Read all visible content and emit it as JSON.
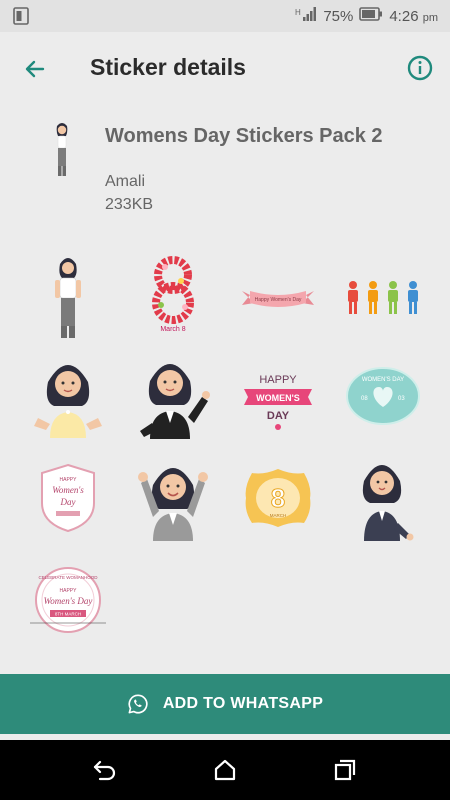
{
  "status_bar": {
    "battery_percent": "75%",
    "time": "4:26",
    "time_suffix": "pm"
  },
  "app_bar": {
    "title": "Sticker details",
    "back_icon": "arrow-left-icon",
    "info_icon": "info-icon"
  },
  "pack": {
    "name": "Womens Day Stickers Pack 2",
    "author": "Amali",
    "size": "233KB"
  },
  "stickers": [
    {
      "name": "woman-white-top"
    },
    {
      "name": "flower-eight-march"
    },
    {
      "name": "happy-womens-day-ribbon"
    },
    {
      "name": "colorful-people-row"
    },
    {
      "name": "woman-yellow-shirt-hands-hips"
    },
    {
      "name": "woman-black-suit-thumbs-up"
    },
    {
      "name": "happy-womens-day-badge"
    },
    {
      "name": "womens-day-heart-label"
    },
    {
      "name": "womens-day-emblem"
    },
    {
      "name": "woman-gray-suit-cheering"
    },
    {
      "name": "gold-eight-badge"
    },
    {
      "name": "woman-dark-suit-pointing"
    },
    {
      "name": "celebrate-womens-day-seal"
    }
  ],
  "sticker_text": {
    "march8": "March 8",
    "ribbon": "Happy Women's Day",
    "badge_happy": "HAPPY",
    "badge_womens": "WOMEN'S",
    "badge_day": "DAY",
    "label_top": "WOMEN'S DAY",
    "label_left": "08",
    "label_right": "03",
    "emblem_happy": "HAPPY",
    "emblem_line1": "Women's",
    "emblem_line2": "Day",
    "gold_eight": "8",
    "gold_sub": "MARCH",
    "seal_arc": "CELEBRATE WOMANHOOD",
    "seal_line1": "HAPPY",
    "seal_line2": "Women's Day",
    "seal_date": "8TH MARCH"
  },
  "action": {
    "label": "ADD TO WHATSAPP",
    "icon": "whatsapp-icon",
    "color": "#2e8b7a"
  },
  "nav": {
    "back_icon": "nav-back-icon",
    "home_icon": "nav-home-icon",
    "recents_icon": "nav-recents-icon"
  }
}
